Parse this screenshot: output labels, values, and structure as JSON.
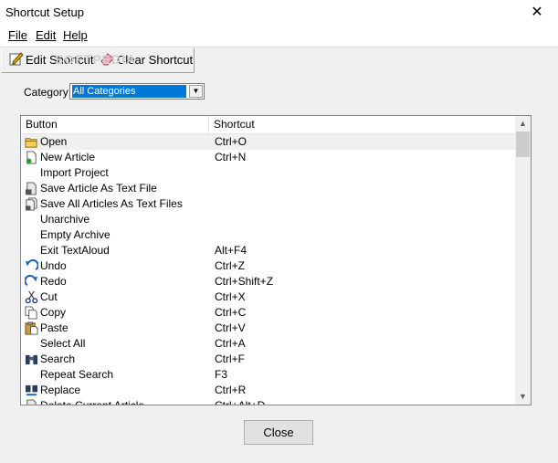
{
  "window": {
    "title": "Shortcut Setup",
    "close_glyph": "✕"
  },
  "menu": [
    "File",
    "Edit",
    "Help"
  ],
  "toolbar": {
    "edit_label": "Edit Shortcut",
    "clear_label": "Clear Shortcut"
  },
  "watermark": "SOFTPEDIA",
  "category": {
    "label": "Category:",
    "value": "All Categories"
  },
  "list": {
    "columns": [
      "Button",
      "Shortcut"
    ],
    "rows": [
      {
        "name": "Open",
        "key": "Ctrl+O",
        "icon": "folder-icon"
      },
      {
        "name": "New Article",
        "key": "Ctrl+N",
        "icon": "new-document-icon"
      },
      {
        "name": "Import Project",
        "key": "",
        "icon": ""
      },
      {
        "name": "Save Article As Text File",
        "key": "",
        "icon": "save-file-icon"
      },
      {
        "name": "Save All Articles As Text Files",
        "key": "",
        "icon": "save-files-icon"
      },
      {
        "name": "Unarchive",
        "key": "",
        "icon": ""
      },
      {
        "name": "Empty Archive",
        "key": "",
        "icon": ""
      },
      {
        "name": "Exit TextAloud",
        "key": "Alt+F4",
        "icon": ""
      },
      {
        "name": "Undo",
        "key": "Ctrl+Z",
        "icon": "undo-icon"
      },
      {
        "name": "Redo",
        "key": "Ctrl+Shift+Z",
        "icon": "redo-icon"
      },
      {
        "name": "Cut",
        "key": "Ctrl+X",
        "icon": "scissors-icon"
      },
      {
        "name": "Copy",
        "key": "Ctrl+C",
        "icon": "copy-icon"
      },
      {
        "name": "Paste",
        "key": "Ctrl+V",
        "icon": "paste-icon"
      },
      {
        "name": "Select All",
        "key": "Ctrl+A",
        "icon": ""
      },
      {
        "name": "Search",
        "key": "Ctrl+F",
        "icon": "binoculars-icon"
      },
      {
        "name": "Repeat Search",
        "key": "F3",
        "icon": ""
      },
      {
        "name": "Replace",
        "key": "Ctrl+R",
        "icon": "replace-icon"
      },
      {
        "name": "Delete Current Article",
        "key": "Ctrl+Alt+D",
        "icon": "delete-icon"
      }
    ]
  },
  "buttons": {
    "close_label": "Close"
  }
}
